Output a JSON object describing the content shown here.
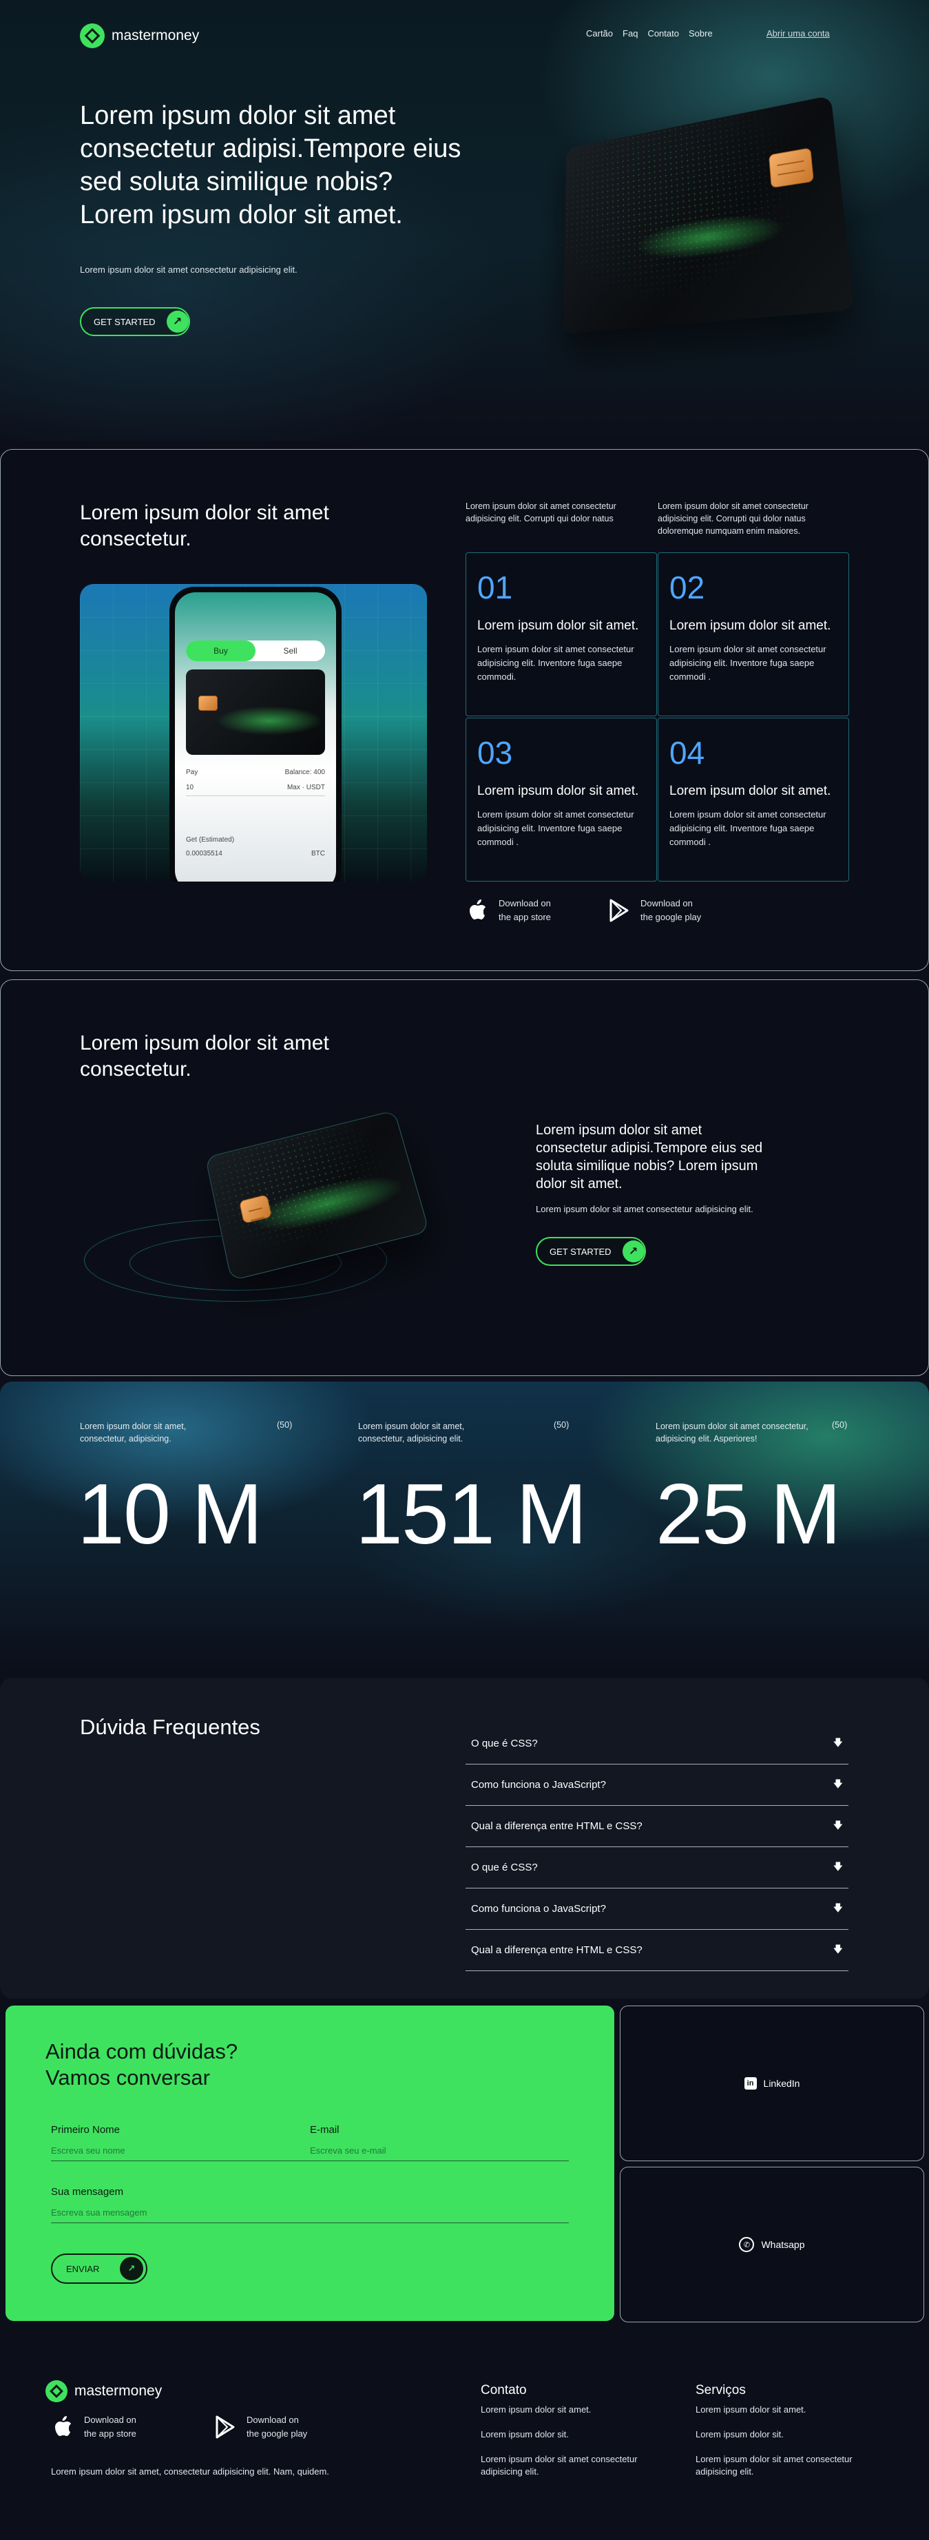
{
  "brand": {
    "name": "mastermoney",
    "accent": "#3fe25e"
  },
  "nav": {
    "links": [
      "Cartão",
      "Faq",
      "Contato",
      "Sobre"
    ],
    "signup": "Abrir uma conta"
  },
  "hero": {
    "title": "Lorem ipsum dolor sit amet consectetur adipisi.Tempore eius sed soluta similique nobis? Lorem ipsum dolor sit amet.",
    "subtitle": "Lorem ipsum dolor sit amet consectetur adipisicing elit.",
    "cta": "GET STARTED"
  },
  "features": {
    "title": "Lorem ipsum dolor sit amet consectetur.",
    "intro_left": "Lorem ipsum dolor sit amet consectetur adipisicing elit. Corrupti qui dolor natus",
    "intro_right": "Lorem ipsum dolor sit amet consectetur adipisicing elit. Corrupti qui dolor natus doloremque numquam enim maiores.",
    "items": [
      {
        "num": "01",
        "title": "Lorem ipsum dolor sit amet.",
        "desc": "Lorem ipsum dolor sit amet consectetur adipisicing elit. Inventore fuga saepe commodi."
      },
      {
        "num": "02",
        "title": "Lorem ipsum dolor sit amet.",
        "desc": "Lorem ipsum dolor sit amet consectetur adipisicing elit. Inventore fuga saepe commodi ."
      },
      {
        "num": "03",
        "title": "Lorem ipsum dolor sit amet.",
        "desc": "Lorem ipsum dolor sit amet consectetur adipisicing elit. Inventore fuga saepe commodi ."
      },
      {
        "num": "04",
        "title": "Lorem ipsum dolor sit amet.",
        "desc": "Lorem ipsum dolor sit amet consectetur adipisicing elit. Inventore fuga saepe commodi ."
      }
    ],
    "phone": {
      "buy": "Buy",
      "sell": "Sell",
      "pay": "Pay",
      "pay_value": "10",
      "pay_currency": "USDT",
      "get": "Get (Estimated)",
      "get_value": "0.00035514",
      "get_currency": "BTC",
      "balance": "Balance: 400",
      "max": "Max"
    },
    "app_store": {
      "line1": "Download on",
      "line2": "the app store"
    },
    "google_play": {
      "line1": "Download on",
      "line2": "the google play"
    }
  },
  "section2": {
    "title": "Lorem ipsum dolor sit amet consectetur.",
    "headline": "Lorem ipsum dolor sit amet consectetur adipisi.Tempore eius sed soluta similique nobis? Lorem ipsum dolor sit amet.",
    "sub": "Lorem ipsum dolor sit amet consectetur adipisicing elit.",
    "cta": "GET STARTED"
  },
  "stats": [
    {
      "text": "Lorem ipsum dolor sit amet, consectetur, adipisicing.",
      "count": "(50)",
      "value": "10 M"
    },
    {
      "text": "Lorem ipsum dolor sit amet, consectetur, adipisicing elit.",
      "count": "(50)",
      "value": "151 M"
    },
    {
      "text": "Lorem ipsum dolor sit amet consectetur, adipisicing elit. Asperiores!",
      "count": "(50)",
      "value": "25 M"
    }
  ],
  "faq": {
    "title": "Dúvida Frequentes",
    "items": [
      "O que é CSS?",
      "Como funciona o JavaScript?",
      "Qual a diferença entre HTML e CSS?",
      "O que é CSS?",
      "Como funciona o JavaScript?",
      "Qual a diferença entre HTML e CSS?"
    ]
  },
  "contact": {
    "title_line1": "Ainda com dúvidas?",
    "title_line2": "Vamos conversar",
    "first_name_label": "Primeiro Nome",
    "first_name_placeholder": "Escreva seu nome",
    "email_label": "E-mail",
    "email_placeholder": "Escreva seu e-mail",
    "message_label": "Sua mensagem",
    "message_placeholder": "Escreva sua mensagem",
    "send": "ENVIAR",
    "linkedin": "LinkedIn",
    "whatsapp": "Whatsapp"
  },
  "footer": {
    "brand": "mastermoney",
    "app_store": {
      "line1": "Download on",
      "line2": "the app store"
    },
    "google_play": {
      "line1": "Download on",
      "line2": "the google play"
    },
    "tagline": "Lorem ipsum dolor sit amet, consectetur adipisicing elit. Nam, quidem.",
    "contact_head": "Contato",
    "contact_items": [
      "Lorem ipsum dolor sit amet.",
      "Lorem ipsum dolor sit.",
      "Lorem ipsum dolor sit amet consectetur adipisicing elit."
    ],
    "services_head": "Serviços",
    "services_items": [
      "Lorem ipsum dolor sit amet.",
      "Lorem ipsum dolor sit.",
      "Lorem ipsum dolor sit amet consectetur adipisicing elit."
    ]
  }
}
